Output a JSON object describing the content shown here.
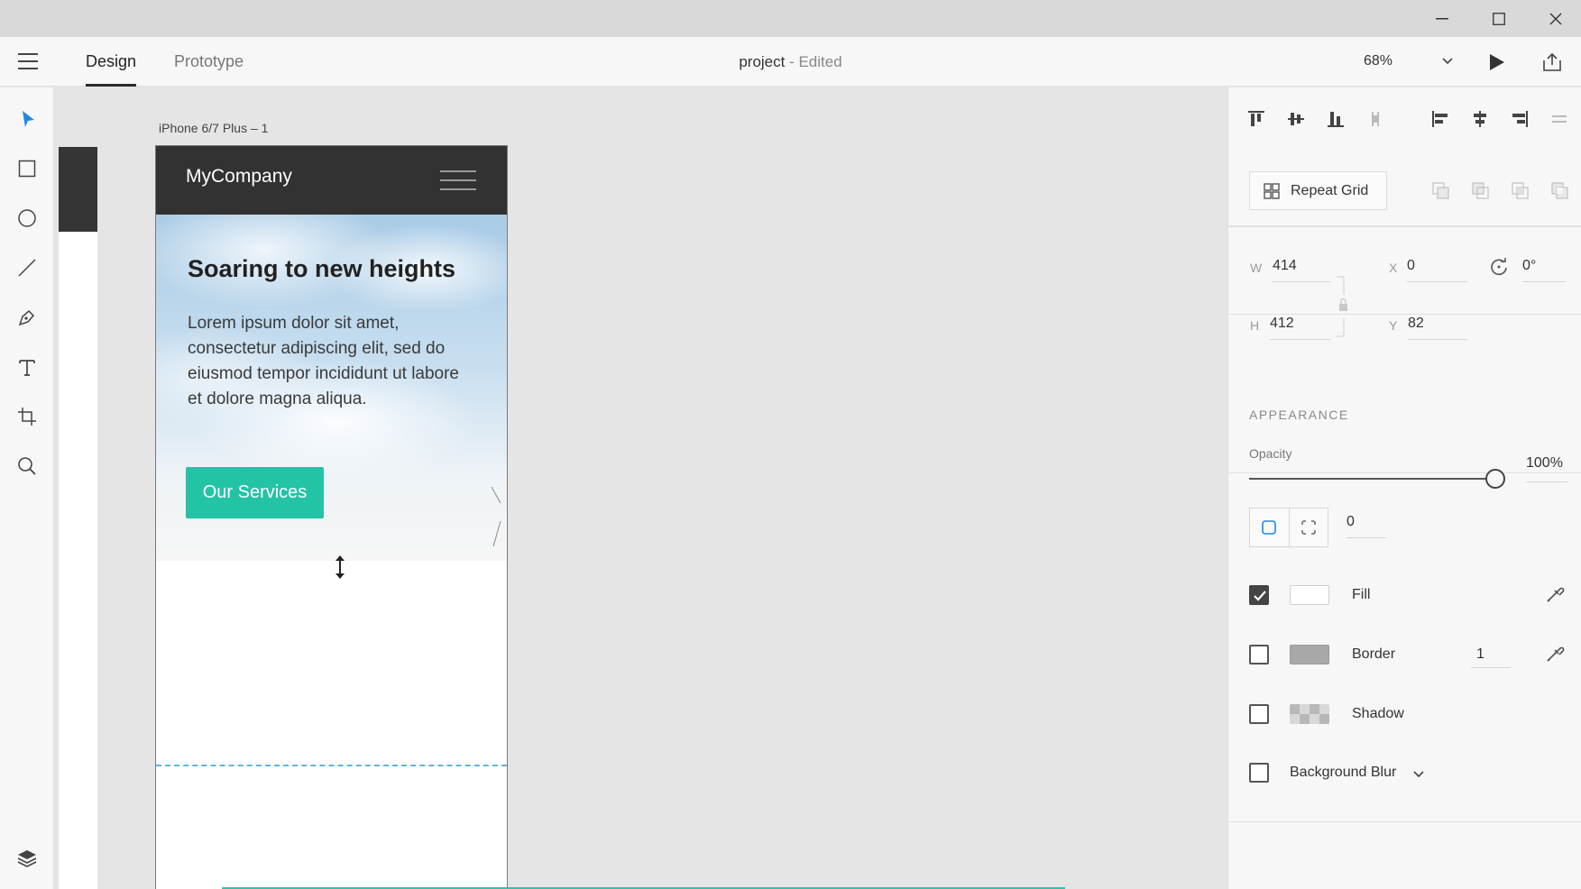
{
  "header": {
    "tabs": [
      {
        "label": "Design",
        "active": true
      },
      {
        "label": "Prototype",
        "active": false
      }
    ],
    "document_name": "project",
    "document_status": " - Edited",
    "zoom": "68%"
  },
  "canvas": {
    "artboard_label": "iPhone 6/7 Plus – 1",
    "site": {
      "brand": "MyCompany",
      "hero_title": "Soaring to new heights",
      "hero_body": "Lorem ipsum dolor sit amet, consectetur adipiscing elit, sed do eiusmod tempor incididunt ut labore et dolore magna aliqua.",
      "cta_label": "Our Services"
    }
  },
  "panel": {
    "repeat_grid_label": "Repeat Grid",
    "width_label": "W",
    "width": "414",
    "height_label": "H",
    "height": "412",
    "x_label": "X",
    "x": "0",
    "y_label": "Y",
    "y": "82",
    "rotation": "0°",
    "appearance_title": "APPEARANCE",
    "opacity_label": "Opacity",
    "opacity": "100%",
    "opacity_level": 1.0,
    "corner_radius": "0",
    "fill_label": "Fill",
    "fill_enabled": true,
    "fill_color": "#ffffff",
    "border_label": "Border",
    "border_enabled": false,
    "border_color": "#a8a8a8",
    "border_width": "1",
    "shadow_label": "Shadow",
    "shadow_enabled": false,
    "background_blur_label": "Background Blur",
    "background_blur_enabled": false
  },
  "colors": {
    "accent": "#1e88e5",
    "cta": "#23c3a6",
    "nav_dark": "#323232",
    "fold_line": "#5fb4e0"
  }
}
